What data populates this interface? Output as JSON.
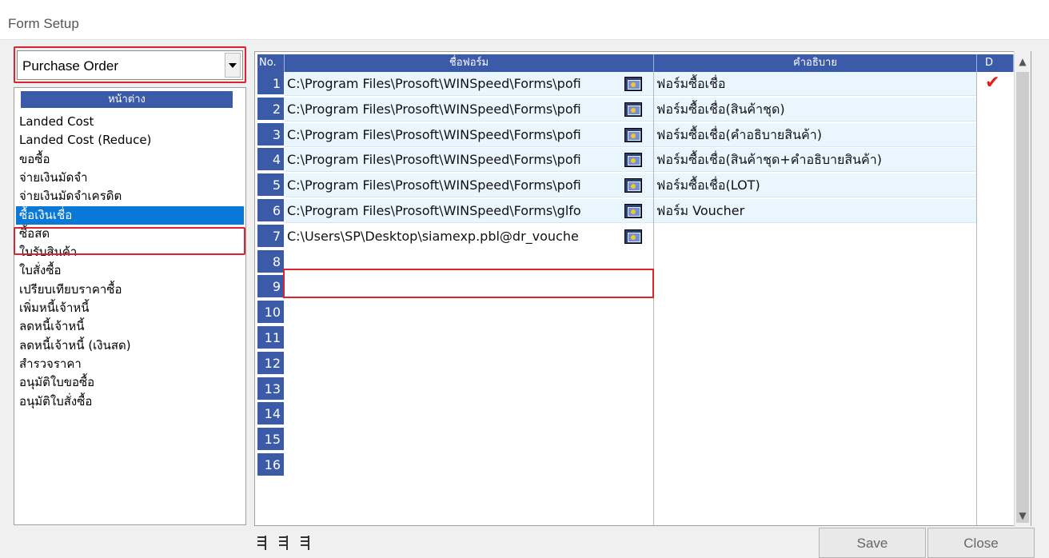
{
  "window": {
    "title": "Form Setup"
  },
  "form_type_combo": {
    "value": "Purchase Order"
  },
  "window_list": {
    "header": "หน้าต่าง",
    "items": [
      "Landed Cost",
      "Landed Cost (Reduce)",
      "ขอซื้อ",
      "จ่ายเงินมัดจำ",
      "จ่ายเงินมัดจำเครดิต",
      "ซื้อเงินเชื่อ",
      "ซื้อสด",
      "ใบรับสินค้า",
      "ใบสั่งซื้อ",
      "เปรียบเทียบราคาซื้อ",
      "เพิ่มหนี้เจ้าหนี้",
      "ลดหนี้เจ้าหนี้",
      "ลดหนี้เจ้าหนี้ (เงินสด)",
      "สำรวจราคา",
      "อนุมัติใบขอซื้อ",
      "อนุมัติใบสั่งซื้อ"
    ],
    "selected": "ซื้อเงินเชื่อ"
  },
  "grid": {
    "columns": [
      "No.",
      "ชื่อฟอร์ม",
      "คำอธิบาย",
      "D"
    ],
    "rows": [
      {
        "no": "1",
        "form": "C:\\Program Files\\Prosoft\\WINSpeed\\Forms\\pofi",
        "desc": "ฟอร์มซื้อเชื่อ",
        "d": "✔"
      },
      {
        "no": "2",
        "form": "C:\\Program Files\\Prosoft\\WINSpeed\\Forms\\pofi",
        "desc": "ฟอร์มซื้อเชื่อ(สินค้าชุด)",
        "d": ""
      },
      {
        "no": "3",
        "form": "C:\\Program Files\\Prosoft\\WINSpeed\\Forms\\pofi",
        "desc": "ฟอร์มซื้อเชื่อ(คำอธิบายสินค้า)",
        "d": ""
      },
      {
        "no": "4",
        "form": "C:\\Program Files\\Prosoft\\WINSpeed\\Forms\\pofi",
        "desc": "ฟอร์มซื้อเชื่อ(สินค้าชุด+คำอธิบายสินค้า)",
        "d": ""
      },
      {
        "no": "5",
        "form": "C:\\Program Files\\Prosoft\\WINSpeed\\Forms\\pofi",
        "desc": "ฟอร์มซื้อเชื่อ(LOT)",
        "d": ""
      },
      {
        "no": "6",
        "form": "C:\\Program Files\\Prosoft\\WINSpeed\\Forms\\glfo",
        "desc": "ฟอร์ม Voucher",
        "d": ""
      },
      {
        "no": "7",
        "form": "C:\\Users\\SP\\Desktop\\siamexp.pbl@dr_vouche",
        "desc": "",
        "d": ""
      },
      {
        "no": "8",
        "form": "",
        "desc": "",
        "d": ""
      },
      {
        "no": "9",
        "form": "",
        "desc": "",
        "d": ""
      },
      {
        "no": "10",
        "form": "",
        "desc": "",
        "d": ""
      },
      {
        "no": "11",
        "form": "",
        "desc": "",
        "d": ""
      },
      {
        "no": "12",
        "form": "",
        "desc": "",
        "d": ""
      },
      {
        "no": "13",
        "form": "",
        "desc": "",
        "d": ""
      },
      {
        "no": "14",
        "form": "",
        "desc": "",
        "d": ""
      },
      {
        "no": "15",
        "form": "",
        "desc": "",
        "d": ""
      },
      {
        "no": "16",
        "form": "",
        "desc": "",
        "d": ""
      }
    ]
  },
  "buttons": {
    "save": "Save",
    "close": "Close"
  },
  "icons": {
    "browse": "browse-icon",
    "toolbar": [
      "insert-row-icon",
      "add-row-icon",
      "delete-row-icon"
    ]
  },
  "colors": {
    "header_blue": "#3b5aa8",
    "selection": "#0a78d7",
    "highlight_red": "#e0212e",
    "row_fill": "#eaf6fd"
  }
}
